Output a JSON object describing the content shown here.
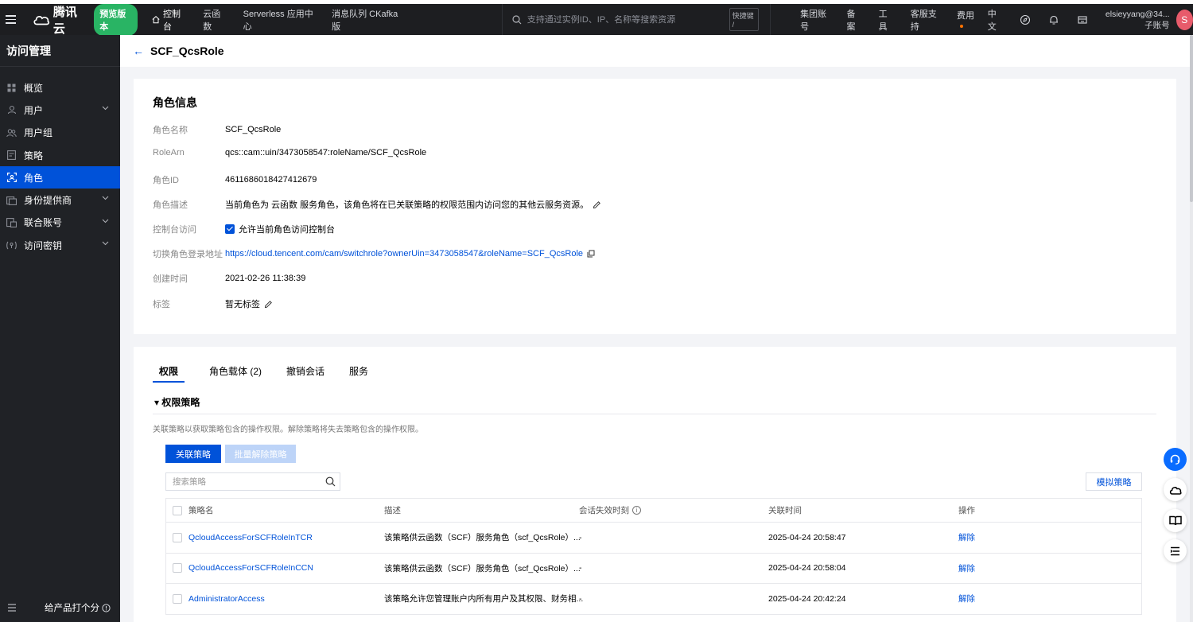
{
  "topbar": {
    "brand": "腾讯云",
    "preview_badge": "预览版本",
    "nav": [
      {
        "label": "控制台"
      },
      {
        "label": "云函数"
      },
      {
        "label": "Serverless 应用中心"
      },
      {
        "label": "消息队列 CKafka 版"
      }
    ],
    "search_placeholder": "支持通过实例ID、IP、名称等搜索资源",
    "shortcut": "快捷键 /",
    "links": [
      "集团账号",
      "备案",
      "工具",
      "客服支持",
      "费用",
      "中文"
    ],
    "user_name": "elsieyyang@34...",
    "user_sub": "子账号",
    "avatar_letter": "S"
  },
  "sidebar": {
    "title": "访问管理",
    "items": [
      {
        "label": "概览",
        "icon": "grid-icon"
      },
      {
        "label": "用户",
        "icon": "user-icon"
      },
      {
        "label": "用户组",
        "icon": "user-group-icon"
      },
      {
        "label": "策略",
        "icon": "policy-icon"
      },
      {
        "label": "角色",
        "icon": "role-icon"
      },
      {
        "label": "身份提供商",
        "icon": "idp-icon"
      },
      {
        "label": "联合账号",
        "icon": "federated-icon"
      },
      {
        "label": "访问密钥",
        "icon": "key-icon"
      }
    ],
    "rate_label": "给产品打个分"
  },
  "page": {
    "title": "SCF_QcsRole"
  },
  "role_info": {
    "heading": "角色信息",
    "name_label": "角色名称",
    "name_value": "SCF_QcsRole",
    "arn_label": "RoleArn",
    "arn_value": "qcs::cam::uin/3473058547:roleName/SCF_QcsRole",
    "id_label": "角色ID",
    "id_value": "4611686018427412679",
    "desc_label": "角色描述",
    "desc_value": "当前角色为 云函数 服务角色，该角色将在已关联策略的权限范围内访问您的其他云服务资源。",
    "console_label": "控制台访问",
    "console_value": "允许当前角色访问控制台",
    "switch_label": "切换角色登录地址",
    "switch_value": "https://cloud.tencent.com/cam/switchrole?ownerUin=3473058547&roleName=SCF_QcsRole",
    "created_label": "创建时间",
    "created_value": "2021-02-26 11:38:39",
    "tags_label": "标签",
    "tags_value": "暂无标签"
  },
  "tabs": [
    "权限",
    "角色载体 (2)",
    "撤销会话",
    "服务"
  ],
  "permissions": {
    "section_title": "权限策略",
    "description": "关联策略以获取策略包含的操作权限。解除策略将失去策略包含的操作权限。",
    "attach_button": "关联策略",
    "batch_detach_button": "批量解除策略",
    "search_placeholder": "搜索策略",
    "simulate_button": "模拟策略",
    "columns": [
      "策略名",
      "描述",
      "会话失效时刻",
      "关联时间",
      "操作"
    ],
    "rows": [
      {
        "name": "QcloudAccessForSCFRoleInTCR",
        "desc": "该策略供云函数（SCF）服务角色（scf_QcsRole）...",
        "expiry": "-",
        "time": "2025-04-24 20:58:47",
        "action": "解除"
      },
      {
        "name": "QcloudAccessForSCFRoleInCCN",
        "desc": "该策略供云函数（SCF）服务角色（scf_QcsRole）...",
        "expiry": "-",
        "time": "2025-04-24 20:58:04",
        "action": "解除"
      },
      {
        "name": "AdministratorAccess",
        "desc": "该策略允许您管理账户内所有用户及其权限、财务相...",
        "expiry": "-",
        "time": "2025-04-24 20:42:24",
        "action": "解除"
      }
    ]
  },
  "colors": {
    "accent": "#0052d9",
    "preview_badge": "#29b464",
    "avatar": "#e85b6b"
  }
}
